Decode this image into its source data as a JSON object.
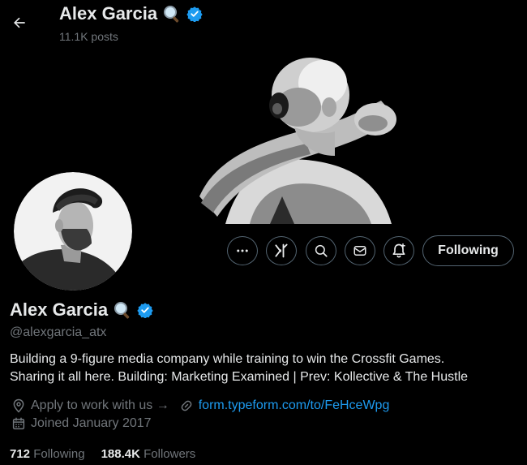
{
  "header": {
    "name": "Alex Garcia",
    "posts": "11.1K posts"
  },
  "profile": {
    "name": "Alex Garcia",
    "handle": "@alexgarcia_atx",
    "bio_line1": "Building a 9-figure media company while training to win the Crossfit Games.",
    "bio_line2": "Sharing it all here. Building: Marketing Examined | Prev: Kollective & The Hustle",
    "apply_text": "Apply to work with us →",
    "link_text": "form.typeform.com/to/FeHceWpg",
    "joined": "Joined January 2017",
    "following_count": "712",
    "following_label": "Following",
    "followers_count": "188.4K",
    "followers_label": "Followers"
  },
  "actions": {
    "following_button": "Following"
  },
  "colors": {
    "accent": "#1d9bf0",
    "muted": "#71767b",
    "text": "#e7e9ea",
    "background": "#000000"
  },
  "icons": [
    "back-arrow-icon",
    "magnifier-emoji-icon",
    "verified-badge-icon",
    "more-icon",
    "grok-icon",
    "search-icon",
    "message-icon",
    "notification-bell-icon",
    "location-icon",
    "link-icon",
    "calendar-icon"
  ]
}
